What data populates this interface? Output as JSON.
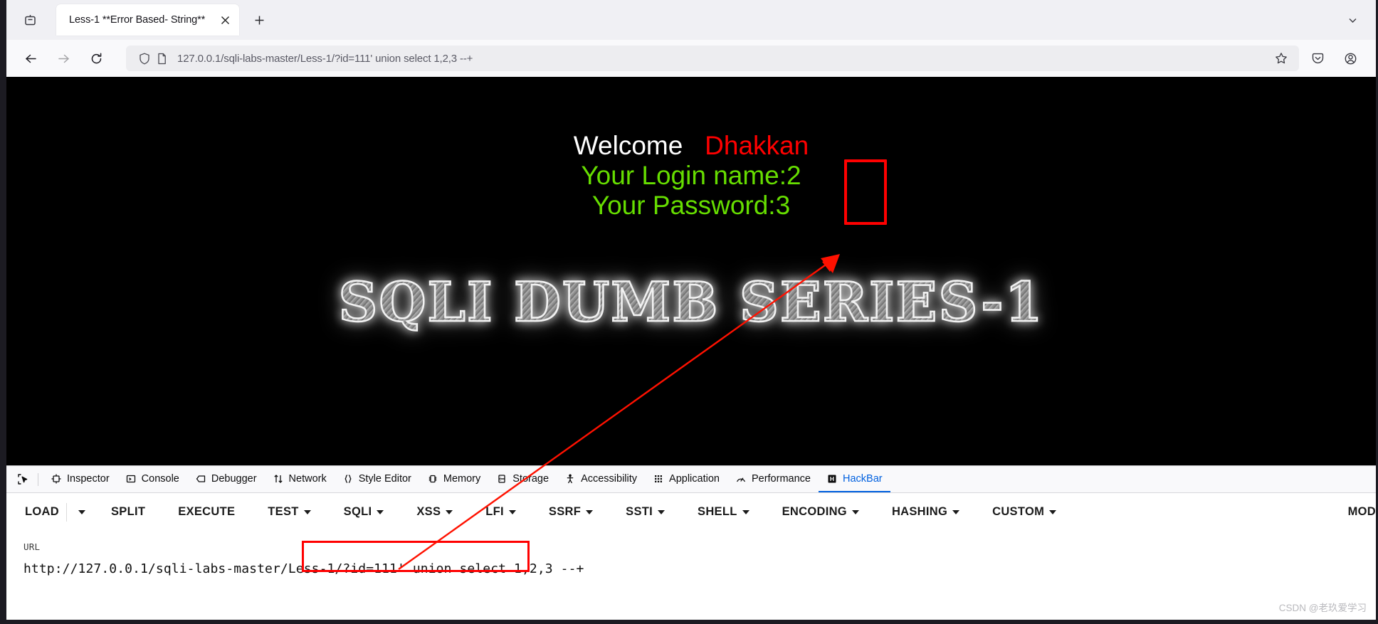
{
  "browser": {
    "tab": {
      "title": "Less-1 **Error Based- String**",
      "close_icon": "close-icon"
    },
    "newtab_label": "+",
    "nav": {
      "back_icon": "back-arrow-icon",
      "forward_icon": "forward-arrow-icon",
      "reload_icon": "reload-icon",
      "shield_icon": "shield-icon",
      "page_icon": "page-document-icon",
      "bookmark_icon": "star-icon",
      "pocket_icon": "pocket-icon",
      "account_icon": "account-icon"
    },
    "url": "127.0.0.1/sqli-labs-master/Less-1/?id=111' union select 1,2,3 --+",
    "url_host": "127.0.0.1",
    "url_path": "/sqli-labs-master/Less-1/?id=111' union select 1,2,3 --+"
  },
  "page": {
    "welcome_label": "Welcome",
    "user_name": "Dhakkan",
    "login_name_line": "Your Login name:2",
    "password_line": "Your Password:3",
    "logo_text": "SQLI DUMB SERIES-1",
    "colors": {
      "background": "#000000",
      "welcome": "#ffffff",
      "username": "#ff0000",
      "credentials": "#66dd00",
      "annotation": "#ff0000"
    }
  },
  "devtools": {
    "picker_icon": "element-picker-icon",
    "tabs": [
      {
        "label": "Inspector",
        "icon": "inspector-icon",
        "active": false
      },
      {
        "label": "Console",
        "icon": "console-icon",
        "active": false
      },
      {
        "label": "Debugger",
        "icon": "debugger-icon",
        "active": false
      },
      {
        "label": "Network",
        "icon": "network-icon",
        "active": false
      },
      {
        "label": "Style Editor",
        "icon": "style-editor-icon",
        "active": false
      },
      {
        "label": "Memory",
        "icon": "memory-icon",
        "active": false
      },
      {
        "label": "Storage",
        "icon": "storage-icon",
        "active": false
      },
      {
        "label": "Accessibility",
        "icon": "accessibility-icon",
        "active": false
      },
      {
        "label": "Application",
        "icon": "application-icon",
        "active": false
      },
      {
        "label": "Performance",
        "icon": "performance-icon",
        "active": false
      },
      {
        "label": "HackBar",
        "icon": "hackbar-icon",
        "active": true
      }
    ]
  },
  "hackbar": {
    "buttons": [
      {
        "label": "LOAD",
        "dropdown": true,
        "split": true
      },
      {
        "label": "SPLIT",
        "dropdown": false,
        "split": false
      },
      {
        "label": "EXECUTE",
        "dropdown": false,
        "split": false
      },
      {
        "label": "TEST",
        "dropdown": true,
        "split": false
      },
      {
        "label": "SQLI",
        "dropdown": true,
        "split": false
      },
      {
        "label": "XSS",
        "dropdown": true,
        "split": false
      },
      {
        "label": "LFI",
        "dropdown": true,
        "split": false
      },
      {
        "label": "SSRF",
        "dropdown": true,
        "split": false
      },
      {
        "label": "SSTI",
        "dropdown": true,
        "split": false
      },
      {
        "label": "SHELL",
        "dropdown": true,
        "split": false
      },
      {
        "label": "ENCODING",
        "dropdown": true,
        "split": false
      },
      {
        "label": "HASHING",
        "dropdown": true,
        "split": false
      },
      {
        "label": "CUSTOM",
        "dropdown": true,
        "split": false
      }
    ],
    "overflow_label": "MOD",
    "url_field_label": "URL",
    "url_value_prefix": "http://127.0.0.1/sqli-labs-master/Less-1/",
    "url_value_highlight": "?id=111' union select 1,2,3 --+"
  },
  "watermark": "CSDN @老玖爱学习"
}
